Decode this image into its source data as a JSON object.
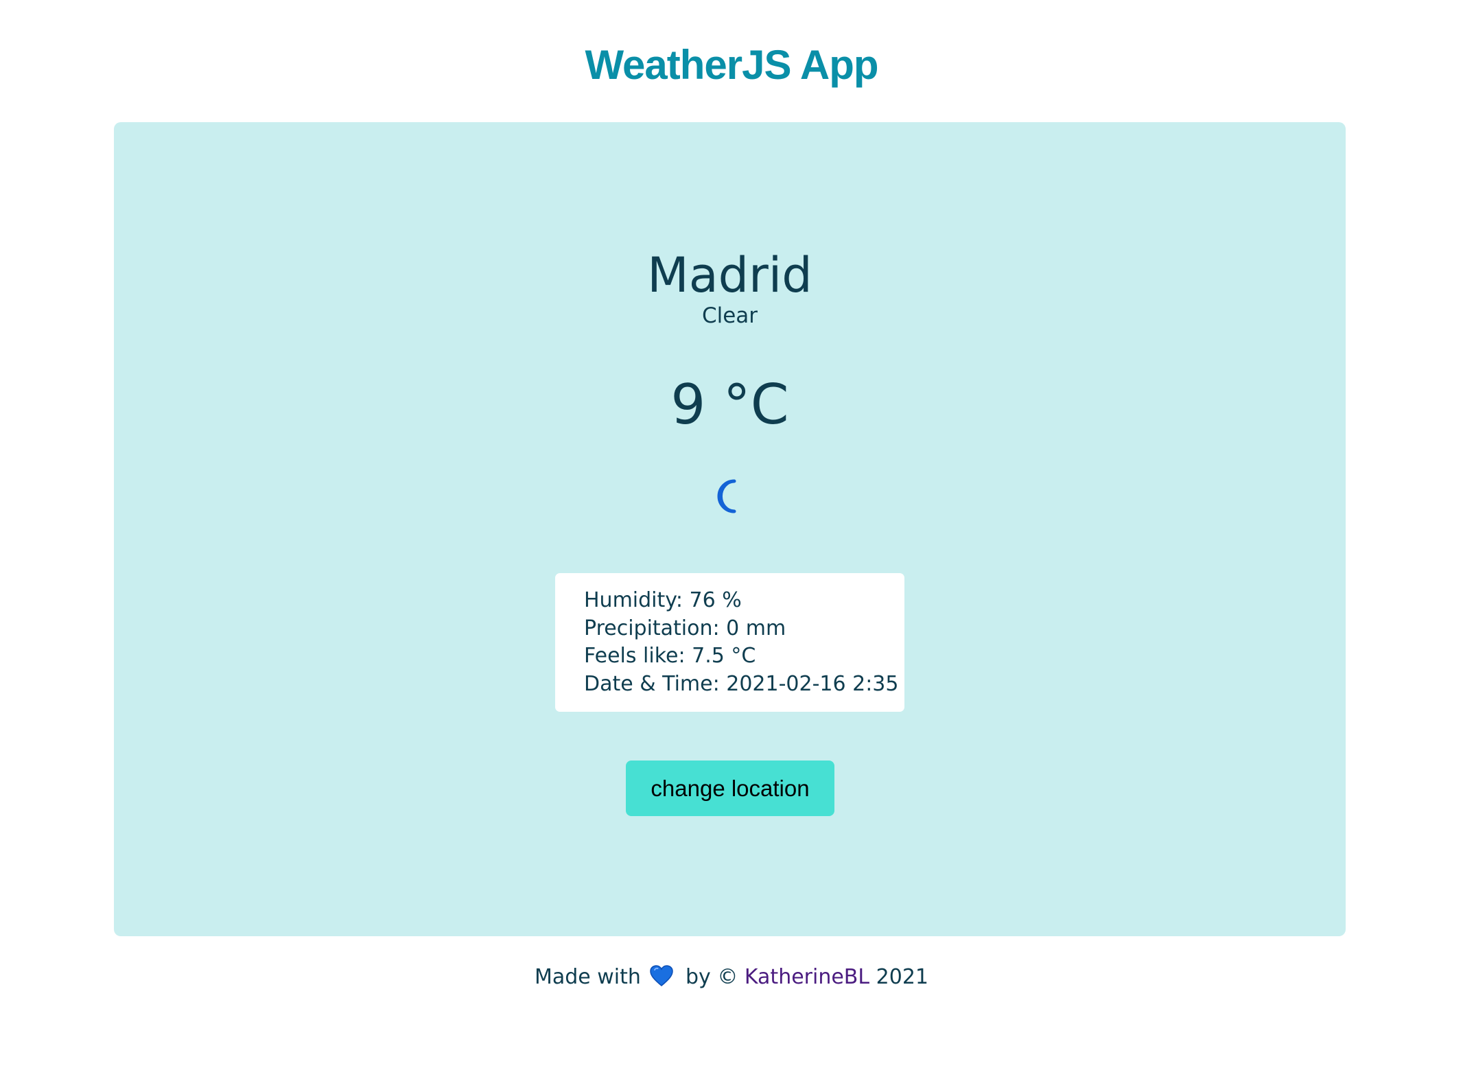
{
  "header": {
    "title": "WeatherJS App"
  },
  "weather": {
    "city": "Madrid",
    "condition": "Clear",
    "temperature": "9 °C",
    "icon": "crescent-moon-icon",
    "details": {
      "humidity": "Humidity: 76 %",
      "precipitation": "Precipitation: 0 mm",
      "feels_like": "Feels like: 7.5 °C",
      "date_time": "Date & Time: 2021-02-16 2:35"
    },
    "change_location_label": "change location"
  },
  "footer": {
    "made_with": "Made with",
    "heart_icon": "blue-heart-icon",
    "by": "by ©",
    "author": "KatherineBL",
    "year": "2021"
  },
  "colors": {
    "title": "#0a8fa8",
    "card_background": "#c9eeef",
    "text": "#0f3d4f",
    "button": "#47e0d3",
    "link": "#4b1c80",
    "moon": "#1463d6"
  }
}
